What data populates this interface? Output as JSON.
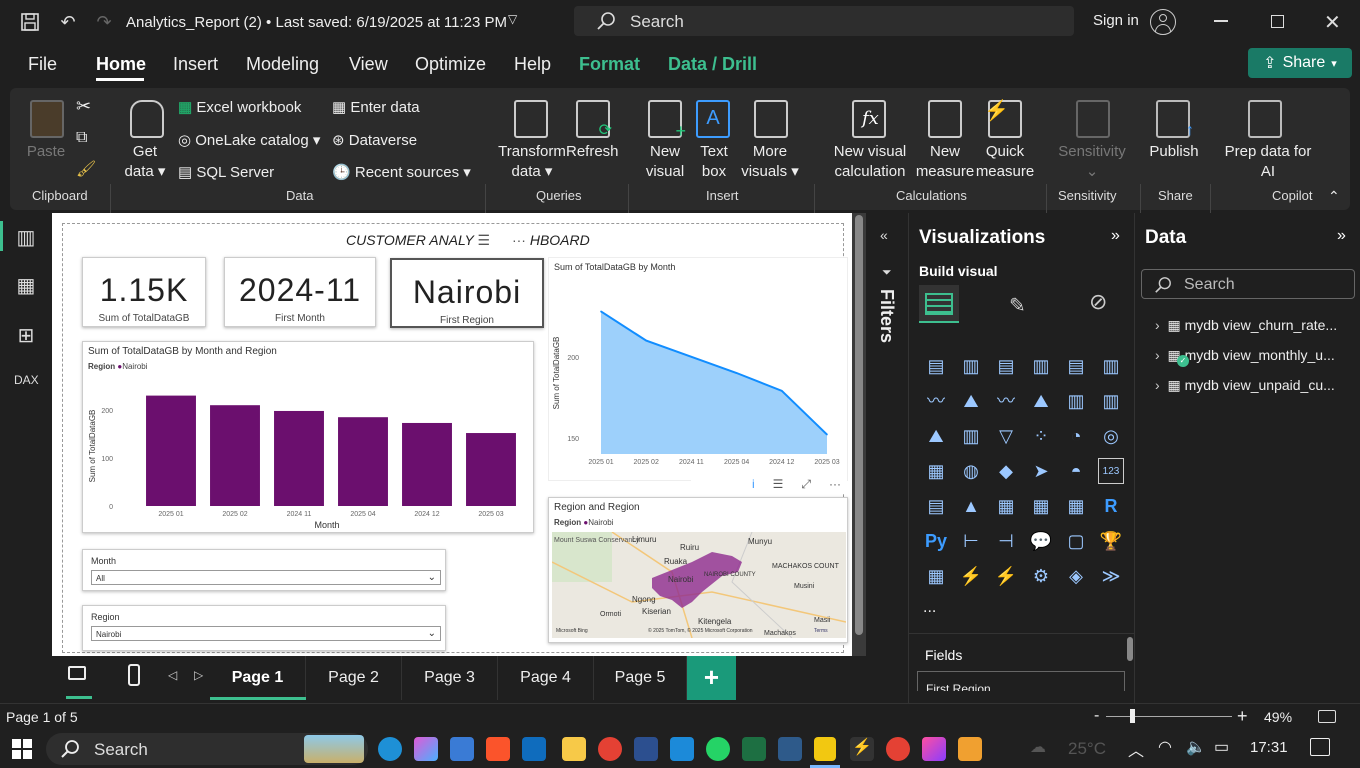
{
  "titlebar": {
    "title": "Analytics_Report (2)  •  Last saved: 6/19/2025 at 11:23 PM",
    "search_placeholder": "Search",
    "signin": "Sign in"
  },
  "menu": {
    "items": [
      "File",
      "Home",
      "Insert",
      "Modeling",
      "View",
      "Optimize",
      "Help",
      "Format",
      "Data / Drill"
    ],
    "share": "Share"
  },
  "ribbon": {
    "paste": "Paste",
    "clipboard": "Clipboard",
    "get_data": "Get data",
    "excel": "Excel workbook",
    "onelake": "OneLake catalog",
    "sql": "SQL Server",
    "enter_data": "Enter data",
    "dataverse": "Dataverse",
    "recent": "Recent sources",
    "data_group": "Data",
    "transform": "Transform data",
    "refresh": "Refresh",
    "queries": "Queries",
    "new_visual": "New visual",
    "text_box": "Text box",
    "more_visuals": "More visuals",
    "insert": "Insert",
    "new_visual_calc": "New visual calculation",
    "new_measure": "New measure",
    "quick_measure": "Quick measure",
    "calculations": "Calculations",
    "sensitivity": "Sensitivity",
    "sensitivity_group": "Sensitivity",
    "publish": "Publish",
    "share_group": "Share",
    "prep_ai": "Prep data for AI",
    "copilot": "Copilot"
  },
  "report": {
    "title": "CUSTOMER ANALY",
    "title_tail": "HBOARD",
    "cards": [
      {
        "value": "1.15K",
        "label": "Sum of TotalDataGB"
      },
      {
        "value": "2024-11",
        "label": "First Month"
      },
      {
        "value": "Nairobi",
        "label": "First Region"
      }
    ],
    "bar_chart": {
      "title": "Sum of TotalDataGB by Month and Region",
      "legend_title": "Region",
      "legend_item": "Nairobi",
      "ylabel": "Sum of TotalDataGB",
      "xlabel": "Month"
    },
    "area_chart": {
      "title": "Sum of TotalDataGB by Month",
      "ylabel": "Sum of TotalDataGB"
    },
    "map": {
      "title": "Region and Region",
      "legend_title": "Region",
      "legend_item": "Nairobi",
      "places": [
        "Mount Suswa Conservancy",
        "Limuru",
        "Ruiru",
        "Munyu",
        "Ruaka",
        "Nairobi",
        "NAIROBI COUNTY",
        "MACHAKOS COUNT",
        "Ngong",
        "Kiserian",
        "Ormoti",
        "Musini",
        "Kitengela",
        "Masii",
        "Machakos"
      ],
      "credit": "© 2025 TomTom, © 2025 Microsoft Corporation",
      "bing": "Microsoft Bing",
      "terms": "Terms"
    },
    "slicers": [
      {
        "label": "Month",
        "value": "All"
      },
      {
        "label": "Region",
        "value": "Nairobi"
      }
    ]
  },
  "chart_data": [
    {
      "type": "bar",
      "title": "Sum of TotalDataGB by Month and Region",
      "xlabel": "Month",
      "ylabel": "Sum of TotalDataGB",
      "categories": [
        "2025 01",
        "2025 02",
        "2024 11",
        "2025 04",
        "2024 12",
        "2025 03"
      ],
      "series": [
        {
          "name": "Nairobi",
          "values": [
            230,
            210,
            198,
            185,
            173,
            152
          ]
        }
      ],
      "yticks": [
        0,
        100,
        200
      ],
      "ylim": [
        0,
        250
      ],
      "color": "#6b0f6e"
    },
    {
      "type": "area",
      "title": "Sum of TotalDataGB by Month",
      "ylabel": "Sum of TotalDataGB",
      "categories": [
        "2025 01",
        "2025 02",
        "2024 11",
        "2025 04",
        "2024 12",
        "2025 03"
      ],
      "values": [
        228,
        210,
        200,
        190,
        179,
        152
      ],
      "yticks": [
        150,
        200
      ],
      "ylim": [
        140,
        240
      ],
      "color": "#118dff"
    }
  ],
  "filters": {
    "label": "Filters"
  },
  "viz": {
    "title": "Visualizations",
    "build": "Build visual",
    "fields": "Fields",
    "field_value": "First Region",
    "more": "..."
  },
  "data": {
    "title": "Data",
    "search": "Search",
    "tables": [
      "mydb view_churn_rate...",
      "mydb view_monthly_u...",
      "mydb view_unpaid_cu..."
    ]
  },
  "pages": {
    "tabs": [
      "Page 1",
      "Page 2",
      "Page 3",
      "Page 4",
      "Page 5"
    ],
    "add": "+"
  },
  "status": {
    "page": "Page 1 of 5",
    "zoom": "49%"
  },
  "taskbar": {
    "search": "Search",
    "temp": "25°C",
    "time": "17:31"
  }
}
